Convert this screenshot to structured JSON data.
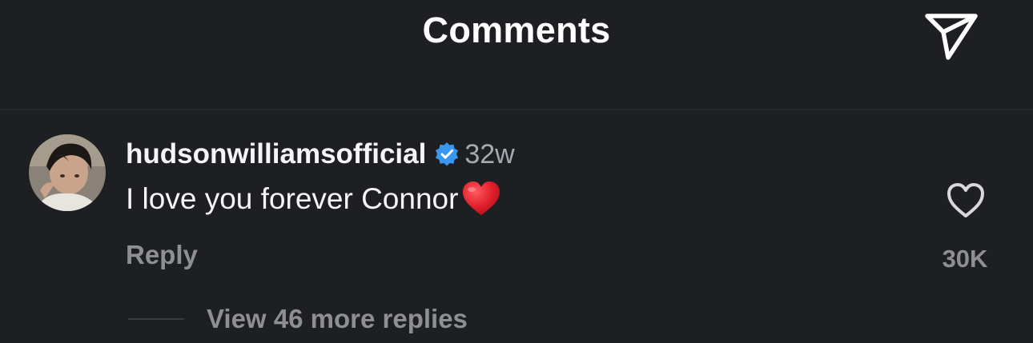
{
  "header": {
    "title": "Comments",
    "share_icon": "paper-plane-icon"
  },
  "comment": {
    "avatar_icon": "profile-photo",
    "username": "hudsonwilliamsofficial",
    "verified_icon": "verified-badge-icon",
    "timestamp": "32w",
    "text": "I love you forever Connor",
    "emoji": "red-heart-emoji",
    "reply_label": "Reply",
    "like_icon": "heart-outline-icon",
    "like_count": "30K",
    "view_replies_label": "View 46 more replies"
  },
  "colors": {
    "background": "#1e1f23",
    "primary_text": "#f5f5f7",
    "secondary_text": "#8e8e95",
    "verified_blue": "#3897f0",
    "heart_red": "#e0202b"
  }
}
